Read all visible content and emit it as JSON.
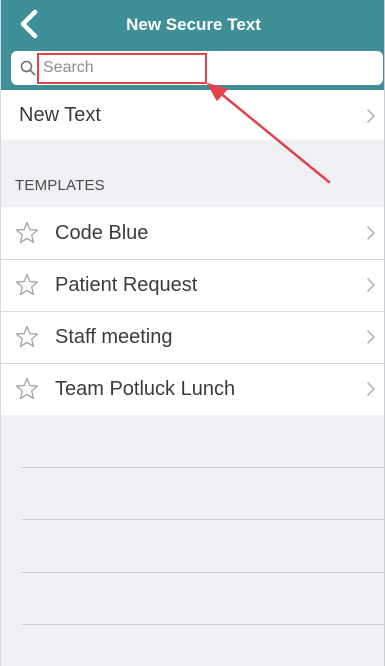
{
  "nav": {
    "title": "New Secure Text"
  },
  "search": {
    "placeholder": "Search",
    "value": ""
  },
  "new_text": {
    "label": "New Text"
  },
  "templates": {
    "header": "TEMPLATES",
    "items": [
      {
        "label": "Code Blue"
      },
      {
        "label": "Patient Request"
      },
      {
        "label": "Staff meeting"
      },
      {
        "label": "Team Potluck Lunch"
      }
    ]
  },
  "colors": {
    "navbar": "#3f8f96",
    "annotation": "#e2434a",
    "background": "#eef0f3"
  },
  "icons": {
    "back": "chevron-left-icon",
    "search": "magnifier-icon",
    "star": "star-outline-icon",
    "chevron": "chevron-right-icon"
  }
}
